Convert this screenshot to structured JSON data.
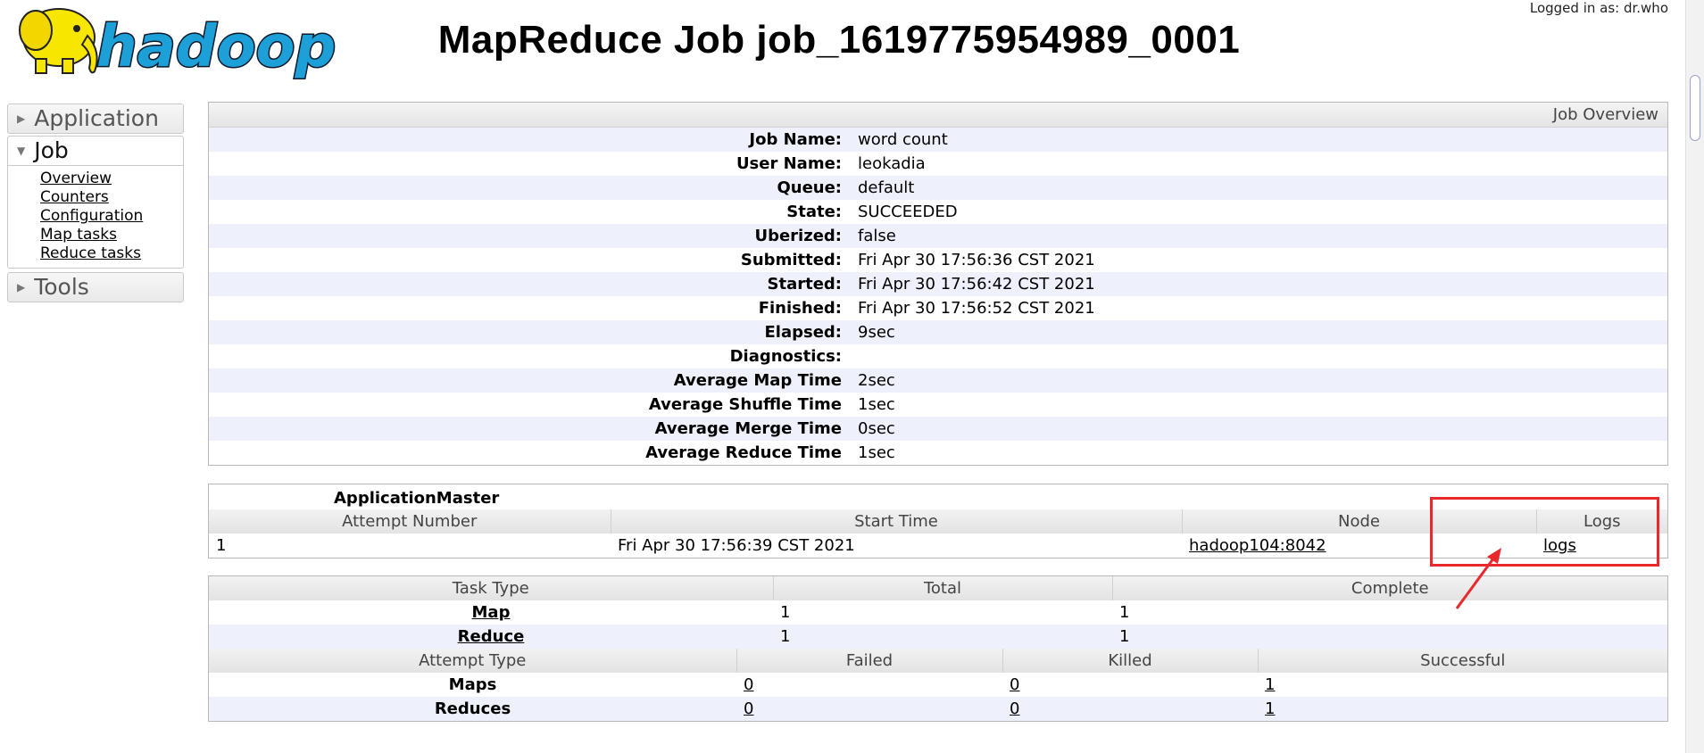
{
  "header": {
    "logo_text": "hadoop",
    "title": "MapReduce Job job_1619775954989_0001",
    "logged_in": "Logged in as: dr.who"
  },
  "sidebar": {
    "application_label": "Application",
    "job_label": "Job",
    "job_links": [
      "Overview",
      "Counters",
      "Configuration",
      "Map tasks",
      "Reduce tasks"
    ],
    "tools_label": "Tools"
  },
  "overview": {
    "caption": "Job Overview",
    "rows": [
      {
        "label": "Job Name:",
        "value": "word count"
      },
      {
        "label": "User Name:",
        "value": "leokadia"
      },
      {
        "label": "Queue:",
        "value": "default"
      },
      {
        "label": "State:",
        "value": "SUCCEEDED"
      },
      {
        "label": "Uberized:",
        "value": "false"
      },
      {
        "label": "Submitted:",
        "value": "Fri Apr 30 17:56:36 CST 2021"
      },
      {
        "label": "Started:",
        "value": "Fri Apr 30 17:56:42 CST 2021"
      },
      {
        "label": "Finished:",
        "value": "Fri Apr 30 17:56:52 CST 2021"
      },
      {
        "label": "Elapsed:",
        "value": "9sec"
      },
      {
        "label": "Diagnostics:",
        "value": ""
      },
      {
        "label": "Average Map Time",
        "value": "2sec"
      },
      {
        "label": "Average Shuffle Time",
        "value": "1sec"
      },
      {
        "label": "Average Merge Time",
        "value": "0sec"
      },
      {
        "label": "Average Reduce Time",
        "value": "1sec"
      }
    ]
  },
  "app_master": {
    "title": "ApplicationMaster",
    "headers": [
      "Attempt Number",
      "Start Time",
      "Node",
      "Logs"
    ],
    "row": {
      "attempt": "1",
      "start_time": "Fri Apr 30 17:56:39 CST 2021",
      "node": "hadoop104:8042",
      "logs": "logs"
    }
  },
  "tasks": {
    "headers": [
      "Task Type",
      "Total",
      "Complete"
    ],
    "rows": [
      {
        "type": "Map",
        "total": "1",
        "complete": "1"
      },
      {
        "type": "Reduce",
        "total": "1",
        "complete": "1"
      }
    ]
  },
  "attempts": {
    "headers": [
      "Attempt Type",
      "Failed",
      "Killed",
      "Successful"
    ],
    "rows": [
      {
        "type": "Maps",
        "failed": "0",
        "killed": "0",
        "successful": "1"
      },
      {
        "type": "Reduces",
        "failed": "0",
        "killed": "0",
        "successful": "1"
      }
    ]
  },
  "colors": {
    "stripe": "#eef0fb",
    "annotation": "#e8282b",
    "logo_yellow": "#f7e600",
    "logo_blue": "#1d9fd8"
  }
}
